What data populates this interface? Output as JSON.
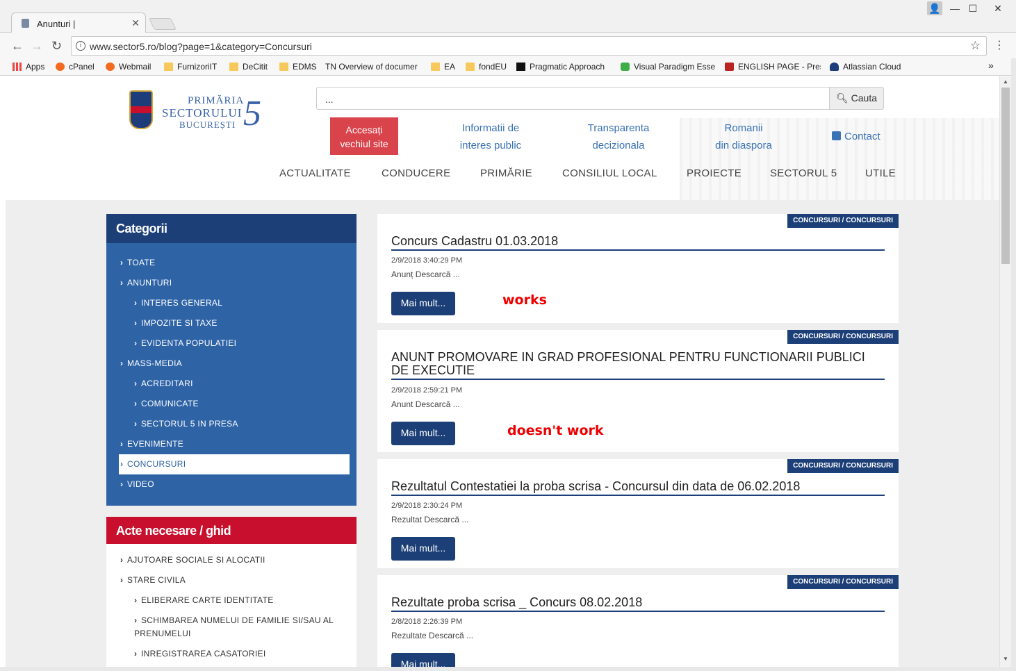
{
  "browser": {
    "tab_title": "Anunturi |",
    "url": "www.sector5.ro/blog?page=1&category=Concursuri",
    "bookmarks": [
      "Apps",
      "cPanel",
      "Webmail",
      "FurnizoriIT",
      "DeCitit",
      "EDMS",
      "TN  Overview of documer",
      "EA",
      "fondEU",
      "Pragmatic Approach",
      "Visual Paradigm Esse",
      "ENGLISH PAGE - Pres",
      "Atlassian Cloud"
    ],
    "bookmarks_more": "»"
  },
  "logo": {
    "line1": "PRIMĂRIA",
    "line2": "SECTORULUI",
    "line3": "BUCUREȘTI",
    "num": "5"
  },
  "search": {
    "value": "...",
    "button": "Cauta"
  },
  "header": {
    "old_site": "Accesați vechiul site",
    "links": [
      {
        "l1": "Informatii de",
        "l2": "interes public"
      },
      {
        "l1": "Transparenta",
        "l2": "decizionala"
      },
      {
        "l1": "Romanii",
        "l2": "din diaspora"
      }
    ],
    "contact": "Contact"
  },
  "nav": [
    "ACTUALITATE",
    "CONDUCERE",
    "PRIMĂRIE",
    "CONSILIUL LOCAL",
    "PROIECTE",
    "SECTORUL 5",
    "UTILE"
  ],
  "categories": {
    "title": "Categorii",
    "items": [
      "TOATE",
      "ANUNTURI",
      "INTERES GENERAL",
      "IMPOZITE SI TAXE",
      "EVIDENTA POPULATIEI",
      "MASS-MEDIA",
      "ACREDITARI",
      "COMUNICATE",
      "SECTORUL 5 IN PRESA",
      "EVENIMENTE",
      "CONCURSURI",
      "VIDEO"
    ]
  },
  "acte": {
    "title": "Acte necesare / ghid",
    "items": [
      "AJUTOARE SOCIALE SI ALOCATII",
      "STARE CIVILA",
      "ELIBERARE CARTE IDENTITATE",
      "SCHIMBAREA NUMELUI DE FAMILIE SI/SAU AL PRENUMELUI",
      "INREGISTRAREA CASATORIEI"
    ]
  },
  "posts": [
    {
      "badge": "CONCURSURI / CONCURSURI",
      "title": "Concurs Cadastru 01.03.2018",
      "date": "2/9/2018 3:40:29 PM",
      "excerpt": "Anunț Descarcă ...",
      "button": "Mai mult..."
    },
    {
      "badge": "CONCURSURI / CONCURSURI",
      "title": "ANUNT PROMOVARE IN GRAD PROFESIONAL PENTRU FUNCTIONARII PUBLICI DE EXECUTIE",
      "date": "2/9/2018 2:59:21 PM",
      "excerpt": "Anunt Descarcă ...",
      "button": "Mai mult..."
    },
    {
      "badge": "CONCURSURI / CONCURSURI",
      "title": "Rezultatul Contestatiei la proba scrisa - Concursul din data de 06.02.2018",
      "date": "2/9/2018 2:30:24 PM",
      "excerpt": "Rezultat Descarcă ...",
      "button": "Mai mult..."
    },
    {
      "badge": "CONCURSURI / CONCURSURI",
      "title": "Rezultate proba scrisa _ Concurs 08.02.2018",
      "date": "2/8/2018 2:26:39 PM",
      "excerpt": "Rezultate Descarcă ...",
      "button": "Mai mult..."
    }
  ],
  "annotations": {
    "works": "works",
    "doesnt": "doesn't work"
  },
  "colors": {
    "navy": "#1c3f78",
    "blue": "#2e63a6",
    "red": "#c8102e",
    "note": "#e00000"
  }
}
